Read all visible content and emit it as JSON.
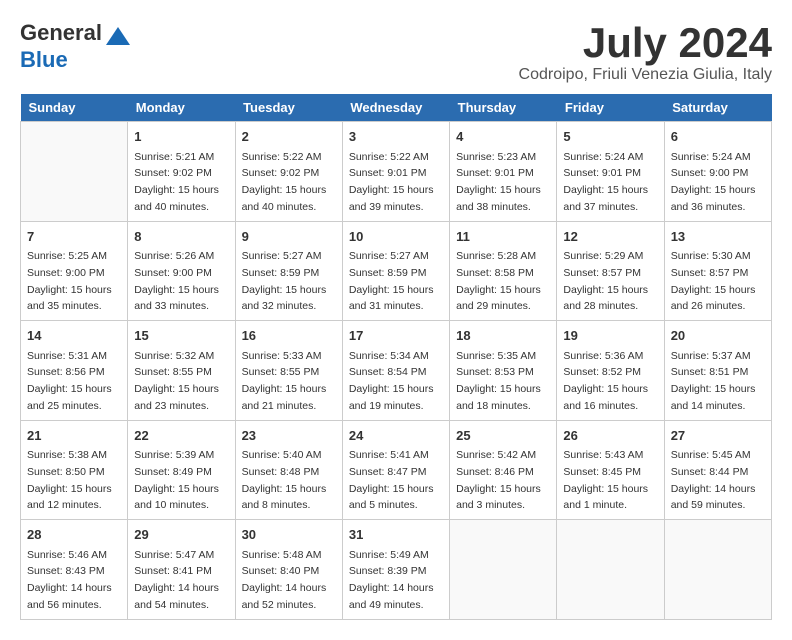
{
  "header": {
    "logo_general": "General",
    "logo_blue": "Blue",
    "month": "July 2024",
    "location": "Codroipo, Friuli Venezia Giulia, Italy"
  },
  "weekdays": [
    "Sunday",
    "Monday",
    "Tuesday",
    "Wednesday",
    "Thursday",
    "Friday",
    "Saturday"
  ],
  "weeks": [
    [
      {
        "day": "",
        "info": ""
      },
      {
        "day": "1",
        "info": "Sunrise: 5:21 AM\nSunset: 9:02 PM\nDaylight: 15 hours\nand 40 minutes."
      },
      {
        "day": "2",
        "info": "Sunrise: 5:22 AM\nSunset: 9:02 PM\nDaylight: 15 hours\nand 40 minutes."
      },
      {
        "day": "3",
        "info": "Sunrise: 5:22 AM\nSunset: 9:01 PM\nDaylight: 15 hours\nand 39 minutes."
      },
      {
        "day": "4",
        "info": "Sunrise: 5:23 AM\nSunset: 9:01 PM\nDaylight: 15 hours\nand 38 minutes."
      },
      {
        "day": "5",
        "info": "Sunrise: 5:24 AM\nSunset: 9:01 PM\nDaylight: 15 hours\nand 37 minutes."
      },
      {
        "day": "6",
        "info": "Sunrise: 5:24 AM\nSunset: 9:00 PM\nDaylight: 15 hours\nand 36 minutes."
      }
    ],
    [
      {
        "day": "7",
        "info": "Sunrise: 5:25 AM\nSunset: 9:00 PM\nDaylight: 15 hours\nand 35 minutes."
      },
      {
        "day": "8",
        "info": "Sunrise: 5:26 AM\nSunset: 9:00 PM\nDaylight: 15 hours\nand 33 minutes."
      },
      {
        "day": "9",
        "info": "Sunrise: 5:27 AM\nSunset: 8:59 PM\nDaylight: 15 hours\nand 32 minutes."
      },
      {
        "day": "10",
        "info": "Sunrise: 5:27 AM\nSunset: 8:59 PM\nDaylight: 15 hours\nand 31 minutes."
      },
      {
        "day": "11",
        "info": "Sunrise: 5:28 AM\nSunset: 8:58 PM\nDaylight: 15 hours\nand 29 minutes."
      },
      {
        "day": "12",
        "info": "Sunrise: 5:29 AM\nSunset: 8:57 PM\nDaylight: 15 hours\nand 28 minutes."
      },
      {
        "day": "13",
        "info": "Sunrise: 5:30 AM\nSunset: 8:57 PM\nDaylight: 15 hours\nand 26 minutes."
      }
    ],
    [
      {
        "day": "14",
        "info": "Sunrise: 5:31 AM\nSunset: 8:56 PM\nDaylight: 15 hours\nand 25 minutes."
      },
      {
        "day": "15",
        "info": "Sunrise: 5:32 AM\nSunset: 8:55 PM\nDaylight: 15 hours\nand 23 minutes."
      },
      {
        "day": "16",
        "info": "Sunrise: 5:33 AM\nSunset: 8:55 PM\nDaylight: 15 hours\nand 21 minutes."
      },
      {
        "day": "17",
        "info": "Sunrise: 5:34 AM\nSunset: 8:54 PM\nDaylight: 15 hours\nand 19 minutes."
      },
      {
        "day": "18",
        "info": "Sunrise: 5:35 AM\nSunset: 8:53 PM\nDaylight: 15 hours\nand 18 minutes."
      },
      {
        "day": "19",
        "info": "Sunrise: 5:36 AM\nSunset: 8:52 PM\nDaylight: 15 hours\nand 16 minutes."
      },
      {
        "day": "20",
        "info": "Sunrise: 5:37 AM\nSunset: 8:51 PM\nDaylight: 15 hours\nand 14 minutes."
      }
    ],
    [
      {
        "day": "21",
        "info": "Sunrise: 5:38 AM\nSunset: 8:50 PM\nDaylight: 15 hours\nand 12 minutes."
      },
      {
        "day": "22",
        "info": "Sunrise: 5:39 AM\nSunset: 8:49 PM\nDaylight: 15 hours\nand 10 minutes."
      },
      {
        "day": "23",
        "info": "Sunrise: 5:40 AM\nSunset: 8:48 PM\nDaylight: 15 hours\nand 8 minutes."
      },
      {
        "day": "24",
        "info": "Sunrise: 5:41 AM\nSunset: 8:47 PM\nDaylight: 15 hours\nand 5 minutes."
      },
      {
        "day": "25",
        "info": "Sunrise: 5:42 AM\nSunset: 8:46 PM\nDaylight: 15 hours\nand 3 minutes."
      },
      {
        "day": "26",
        "info": "Sunrise: 5:43 AM\nSunset: 8:45 PM\nDaylight: 15 hours\nand 1 minute."
      },
      {
        "day": "27",
        "info": "Sunrise: 5:45 AM\nSunset: 8:44 PM\nDaylight: 14 hours\nand 59 minutes."
      }
    ],
    [
      {
        "day": "28",
        "info": "Sunrise: 5:46 AM\nSunset: 8:43 PM\nDaylight: 14 hours\nand 56 minutes."
      },
      {
        "day": "29",
        "info": "Sunrise: 5:47 AM\nSunset: 8:41 PM\nDaylight: 14 hours\nand 54 minutes."
      },
      {
        "day": "30",
        "info": "Sunrise: 5:48 AM\nSunset: 8:40 PM\nDaylight: 14 hours\nand 52 minutes."
      },
      {
        "day": "31",
        "info": "Sunrise: 5:49 AM\nSunset: 8:39 PM\nDaylight: 14 hours\nand 49 minutes."
      },
      {
        "day": "",
        "info": ""
      },
      {
        "day": "",
        "info": ""
      },
      {
        "day": "",
        "info": ""
      }
    ]
  ]
}
